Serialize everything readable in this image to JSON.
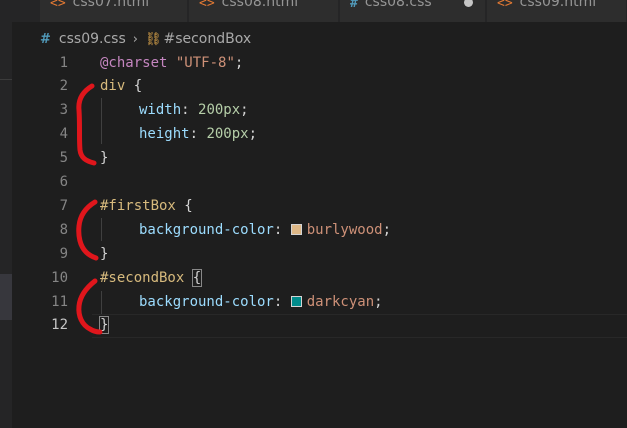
{
  "tabs": [
    {
      "icon": "<>",
      "label": "css07.html"
    },
    {
      "icon": "<>",
      "label": "css08.html"
    },
    {
      "icon": "#",
      "label": "css08.css"
    },
    {
      "icon": "<>",
      "label": "css09.html"
    }
  ],
  "breadcrumb": {
    "file": "css09.css",
    "symbol": "#secondBox"
  },
  "lines": [
    {
      "n": "1"
    },
    {
      "n": "2"
    },
    {
      "n": "3"
    },
    {
      "n": "4"
    },
    {
      "n": "5"
    },
    {
      "n": "6"
    },
    {
      "n": "7"
    },
    {
      "n": "8"
    },
    {
      "n": "9"
    },
    {
      "n": "10"
    },
    {
      "n": "11"
    },
    {
      "n": "12"
    }
  ],
  "code": {
    "l1_at": "@charset",
    "l1_str": "\"UTF-8\"",
    "l1_semi": ";",
    "l2_sel": "div",
    "l2_br": " {",
    "l3_prop": "width",
    "l3_val": "200px",
    "l4_prop": "height",
    "l4_val": "200px",
    "l5_br": "}",
    "l7_sel": "#firstBox",
    "l7_br": " {",
    "l8_prop": "background-color",
    "l8_val": "burlywood",
    "l9_br": "}",
    "l10_sel": "#secondBox",
    "l10_br": "{",
    "l11_prop": "background-color",
    "l11_val": "darkcyan",
    "l12_br": "}",
    "colon": ": ",
    "semi": ";"
  },
  "colors": {
    "burlywood": "#deb887",
    "darkcyan": "#008b8b",
    "annotation": "#e0161c"
  }
}
